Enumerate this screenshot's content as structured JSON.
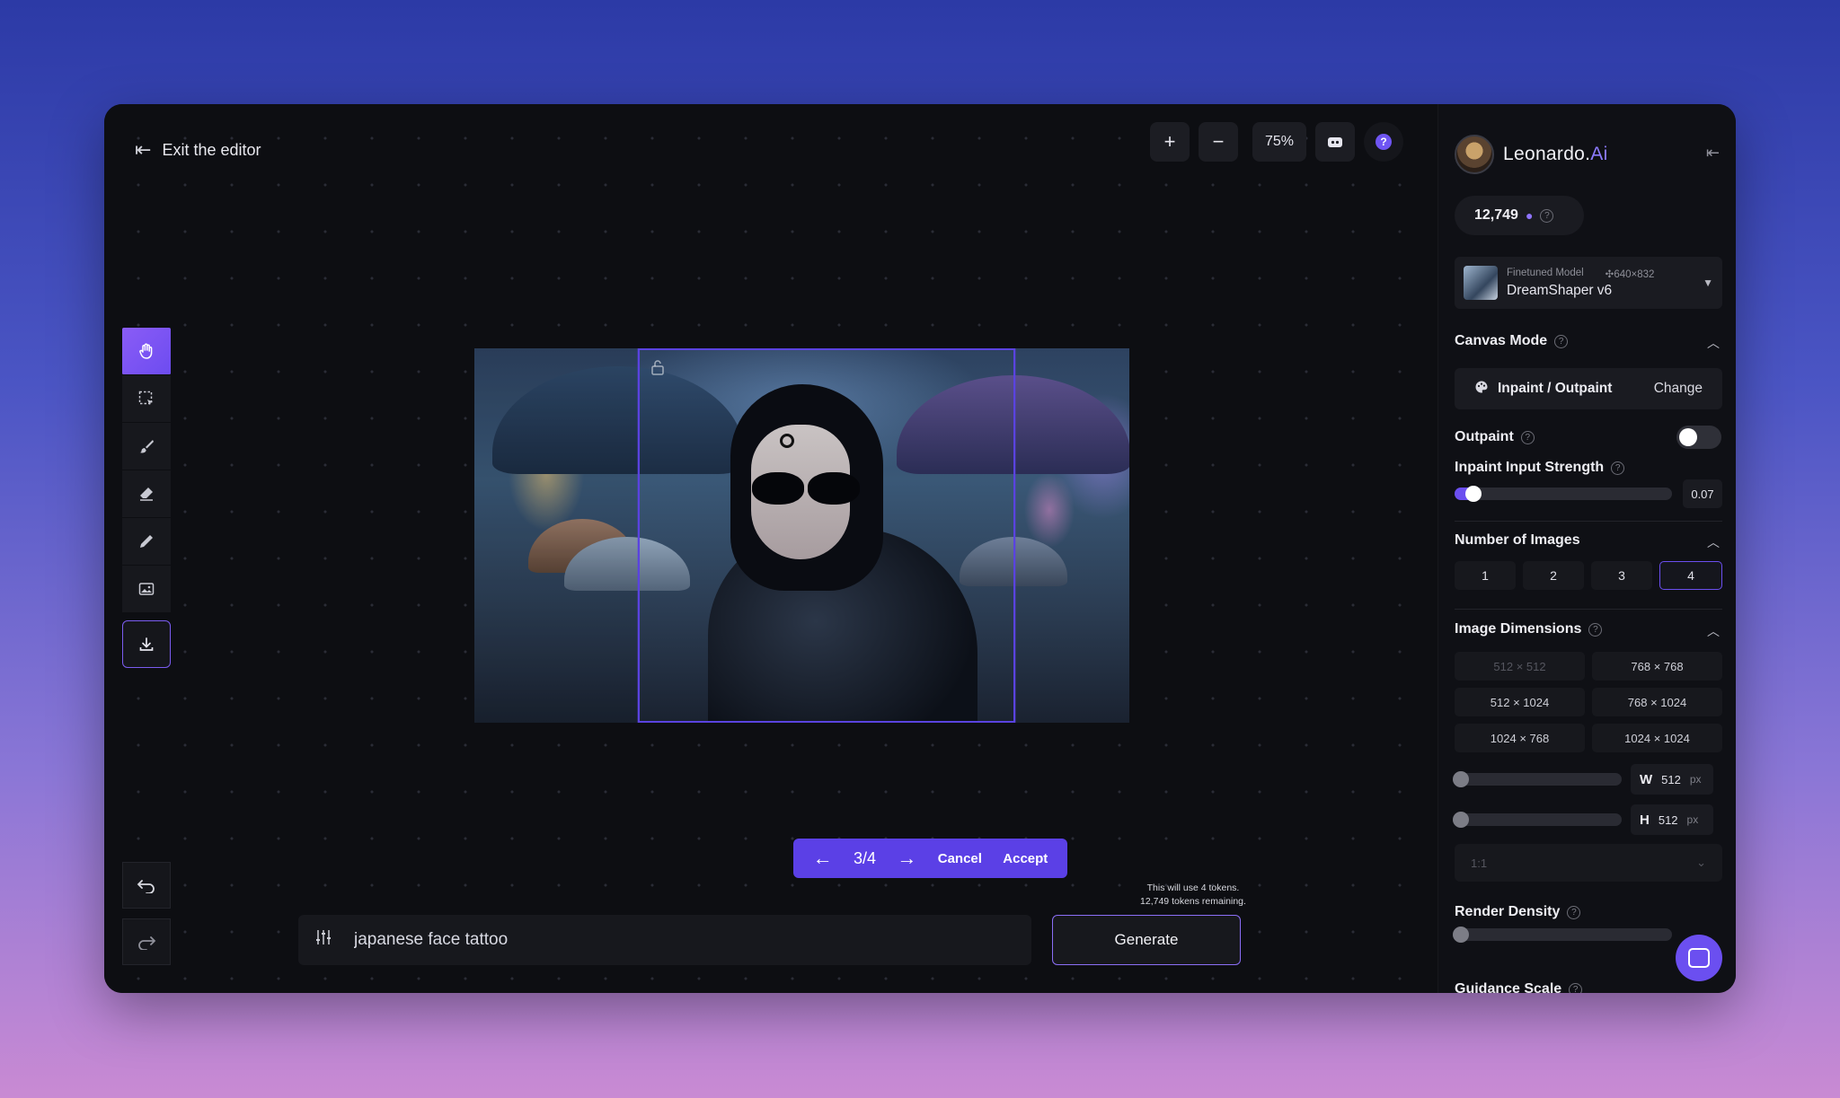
{
  "editor": {
    "exit_label": "Exit the editor",
    "zoom_in": "+",
    "zoom_out": "−",
    "zoom_level": "75%",
    "help_symbol": "?"
  },
  "tools": [
    {
      "name": "hand-tool",
      "icon": "hand-icon"
    },
    {
      "name": "select-tool",
      "icon": "select-icon"
    },
    {
      "name": "brush-tool",
      "icon": "brush-icon"
    },
    {
      "name": "eraser-tool",
      "icon": "eraser-icon"
    },
    {
      "name": "pencil-tool",
      "icon": "pencil-icon"
    },
    {
      "name": "image-tool",
      "icon": "image-icon"
    },
    {
      "name": "download-tool",
      "icon": "download-icon"
    }
  ],
  "navigation": {
    "prev": "←",
    "position": "3/4",
    "next": "→",
    "cancel": "Cancel",
    "accept": "Accept"
  },
  "prompt": {
    "value": "japanese face tattoo",
    "token_note_1": "This will use 4 tokens.",
    "token_note_2": "12,749 tokens remaining.",
    "generate_label": "Generate"
  },
  "panel": {
    "brand": "Leonardo.",
    "brand_suffix": "Ai",
    "credits": "12,749",
    "model": {
      "label": "Finetuned Model",
      "size": "640×832",
      "name": "DreamShaper v6"
    },
    "canvas_mode": {
      "title": "Canvas Mode",
      "mode": "Inpaint / Outpaint",
      "change": "Change"
    },
    "outpaint": {
      "label": "Outpaint",
      "enabled": false
    },
    "inpaint_strength": {
      "label": "Inpaint Input Strength",
      "value": "0.07"
    },
    "num_images": {
      "title": "Number of Images",
      "options": [
        "1",
        "2",
        "3",
        "4"
      ],
      "selected": "4"
    },
    "dimensions": {
      "title": "Image Dimensions",
      "options": [
        "512 × 512",
        "768 × 768",
        "512 × 1024",
        "768 × 1024",
        "1024 × 768",
        "1024 × 1024"
      ],
      "width_key": "W",
      "width": "512",
      "height_key": "H",
      "height": "512",
      "unit": "px",
      "ratio": "1:1"
    },
    "render_density": {
      "label": "Render Density"
    },
    "guidance_scale": {
      "label": "Guidance Scale"
    }
  }
}
